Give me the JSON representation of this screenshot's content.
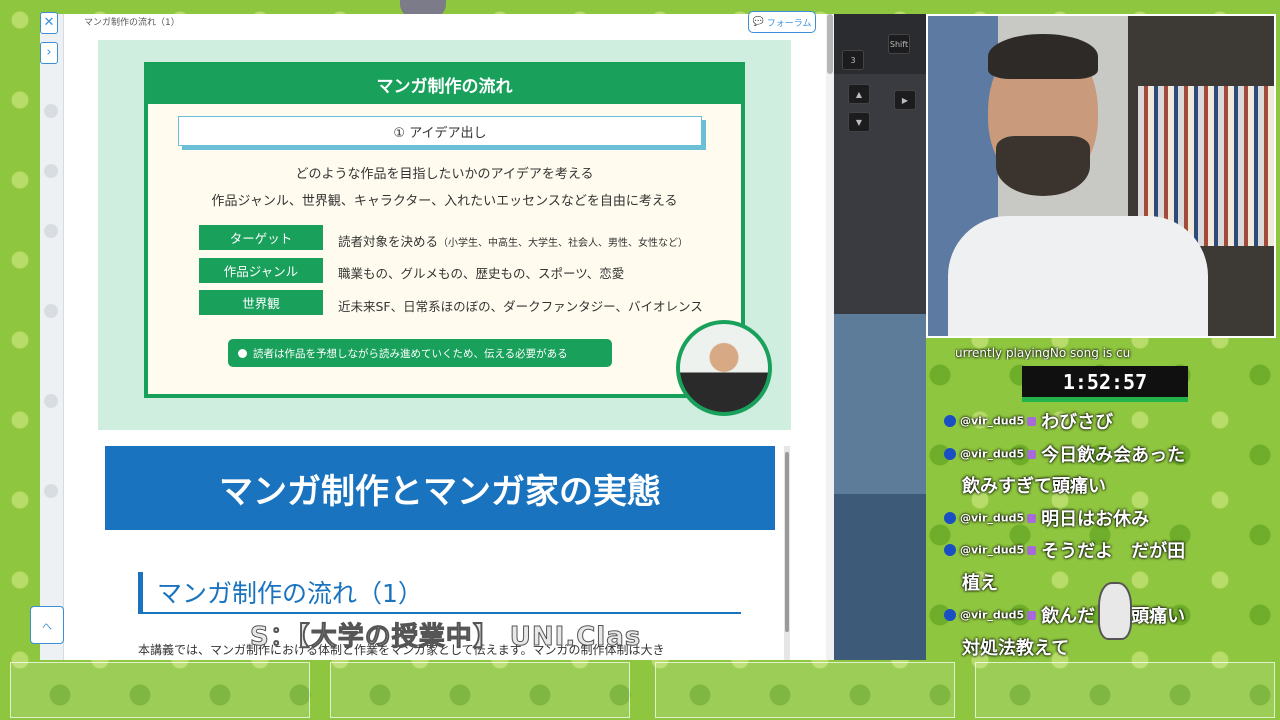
{
  "page": {
    "breadcrumb": "マンガ制作の流れ（1）",
    "forum_label": "フォーラム",
    "side_link_label": "へ"
  },
  "slide": {
    "title": "マンガ制作の流れ",
    "step": "① アイデア出し",
    "intro_line1": "どのような作品を目指したいかのアイデアを考える",
    "intro_line2": "作品ジャンル、世界観、キャラクター、入れたいエッセンスなどを自由に考える",
    "rows": [
      {
        "label": "ターゲット",
        "text": "読者対象を決める",
        "sub": "（小学生、中高生、大学生、社会人、男性、女性など）"
      },
      {
        "label": "作品ジャンル",
        "text": "職業もの、グルメもの、歴史もの、スポーツ、恋愛",
        "sub": ""
      },
      {
        "label": "世界観",
        "text": "近未来SF、日常系ほのぼの、ダークファンタジー、バイオレンス",
        "sub": ""
      }
    ],
    "note": "読者は作品を予想しながら読み進めていくため、伝える必要がある"
  },
  "article": {
    "banner": "マンガ制作とマンガ家の実態",
    "section_heading": "マンガ制作の流れ（1）",
    "body": "本講義では、マンガ制作における体制と作業をマンガ家として伝えます。マンガの制作体制は大き"
  },
  "overlay": {
    "caption": "S：【大学の授業中】 UNI.Clas"
  },
  "desk_keys": [
    "Shift"
  ],
  "stream": {
    "now_playing": "urrently playingNo song is cu",
    "timer": "1:52:57",
    "chat": [
      {
        "user": "@vir_dud5",
        "text": "わびさび",
        "cont": ""
      },
      {
        "user": "@vir_dud5",
        "text": "今日飲み会あった",
        "cont": "飲みすぎて頭痛い"
      },
      {
        "user": "@vir_dud5",
        "text": "明日はお休み",
        "cont": ""
      },
      {
        "user": "@vir_dud5",
        "text": "そうだよ　だが田",
        "cont": "植え"
      },
      {
        "user": "@vir_dud5",
        "text": "飲んだ　　頭痛い",
        "cont": "対処法教えて"
      }
    ]
  },
  "colors": {
    "slide_green": "#19a15c",
    "banner_blue": "#1a73be",
    "timer_bar": "#24b24b",
    "chat_badge": "#a66bd6"
  }
}
